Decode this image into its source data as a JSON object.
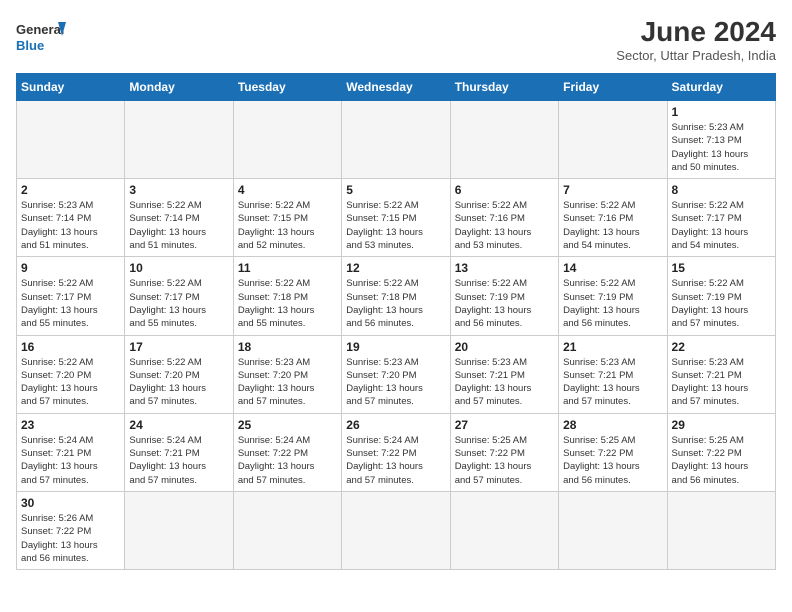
{
  "header": {
    "logo_line1": "General",
    "logo_line2": "Blue",
    "month_title": "June 2024",
    "subtitle": "Sector, Uttar Pradesh, India"
  },
  "weekdays": [
    "Sunday",
    "Monday",
    "Tuesday",
    "Wednesday",
    "Thursday",
    "Friday",
    "Saturday"
  ],
  "weeks": [
    [
      {
        "day": "",
        "info": ""
      },
      {
        "day": "",
        "info": ""
      },
      {
        "day": "",
        "info": ""
      },
      {
        "day": "",
        "info": ""
      },
      {
        "day": "",
        "info": ""
      },
      {
        "day": "",
        "info": ""
      },
      {
        "day": "1",
        "info": "Sunrise: 5:23 AM\nSunset: 7:13 PM\nDaylight: 13 hours\nand 50 minutes."
      }
    ],
    [
      {
        "day": "2",
        "info": "Sunrise: 5:23 AM\nSunset: 7:14 PM\nDaylight: 13 hours\nand 51 minutes."
      },
      {
        "day": "3",
        "info": "Sunrise: 5:22 AM\nSunset: 7:14 PM\nDaylight: 13 hours\nand 51 minutes."
      },
      {
        "day": "4",
        "info": "Sunrise: 5:22 AM\nSunset: 7:15 PM\nDaylight: 13 hours\nand 52 minutes."
      },
      {
        "day": "5",
        "info": "Sunrise: 5:22 AM\nSunset: 7:15 PM\nDaylight: 13 hours\nand 53 minutes."
      },
      {
        "day": "6",
        "info": "Sunrise: 5:22 AM\nSunset: 7:16 PM\nDaylight: 13 hours\nand 53 minutes."
      },
      {
        "day": "7",
        "info": "Sunrise: 5:22 AM\nSunset: 7:16 PM\nDaylight: 13 hours\nand 54 minutes."
      },
      {
        "day": "8",
        "info": "Sunrise: 5:22 AM\nSunset: 7:17 PM\nDaylight: 13 hours\nand 54 minutes."
      }
    ],
    [
      {
        "day": "9",
        "info": "Sunrise: 5:22 AM\nSunset: 7:17 PM\nDaylight: 13 hours\nand 55 minutes."
      },
      {
        "day": "10",
        "info": "Sunrise: 5:22 AM\nSunset: 7:17 PM\nDaylight: 13 hours\nand 55 minutes."
      },
      {
        "day": "11",
        "info": "Sunrise: 5:22 AM\nSunset: 7:18 PM\nDaylight: 13 hours\nand 55 minutes."
      },
      {
        "day": "12",
        "info": "Sunrise: 5:22 AM\nSunset: 7:18 PM\nDaylight: 13 hours\nand 56 minutes."
      },
      {
        "day": "13",
        "info": "Sunrise: 5:22 AM\nSunset: 7:19 PM\nDaylight: 13 hours\nand 56 minutes."
      },
      {
        "day": "14",
        "info": "Sunrise: 5:22 AM\nSunset: 7:19 PM\nDaylight: 13 hours\nand 56 minutes."
      },
      {
        "day": "15",
        "info": "Sunrise: 5:22 AM\nSunset: 7:19 PM\nDaylight: 13 hours\nand 57 minutes."
      }
    ],
    [
      {
        "day": "16",
        "info": "Sunrise: 5:22 AM\nSunset: 7:20 PM\nDaylight: 13 hours\nand 57 minutes."
      },
      {
        "day": "17",
        "info": "Sunrise: 5:22 AM\nSunset: 7:20 PM\nDaylight: 13 hours\nand 57 minutes."
      },
      {
        "day": "18",
        "info": "Sunrise: 5:23 AM\nSunset: 7:20 PM\nDaylight: 13 hours\nand 57 minutes."
      },
      {
        "day": "19",
        "info": "Sunrise: 5:23 AM\nSunset: 7:20 PM\nDaylight: 13 hours\nand 57 minutes."
      },
      {
        "day": "20",
        "info": "Sunrise: 5:23 AM\nSunset: 7:21 PM\nDaylight: 13 hours\nand 57 minutes."
      },
      {
        "day": "21",
        "info": "Sunrise: 5:23 AM\nSunset: 7:21 PM\nDaylight: 13 hours\nand 57 minutes."
      },
      {
        "day": "22",
        "info": "Sunrise: 5:23 AM\nSunset: 7:21 PM\nDaylight: 13 hours\nand 57 minutes."
      }
    ],
    [
      {
        "day": "23",
        "info": "Sunrise: 5:24 AM\nSunset: 7:21 PM\nDaylight: 13 hours\nand 57 minutes."
      },
      {
        "day": "24",
        "info": "Sunrise: 5:24 AM\nSunset: 7:21 PM\nDaylight: 13 hours\nand 57 minutes."
      },
      {
        "day": "25",
        "info": "Sunrise: 5:24 AM\nSunset: 7:22 PM\nDaylight: 13 hours\nand 57 minutes."
      },
      {
        "day": "26",
        "info": "Sunrise: 5:24 AM\nSunset: 7:22 PM\nDaylight: 13 hours\nand 57 minutes."
      },
      {
        "day": "27",
        "info": "Sunrise: 5:25 AM\nSunset: 7:22 PM\nDaylight: 13 hours\nand 57 minutes."
      },
      {
        "day": "28",
        "info": "Sunrise: 5:25 AM\nSunset: 7:22 PM\nDaylight: 13 hours\nand 56 minutes."
      },
      {
        "day": "29",
        "info": "Sunrise: 5:25 AM\nSunset: 7:22 PM\nDaylight: 13 hours\nand 56 minutes."
      }
    ],
    [
      {
        "day": "30",
        "info": "Sunrise: 5:26 AM\nSunset: 7:22 PM\nDaylight: 13 hours\nand 56 minutes."
      },
      {
        "day": "",
        "info": ""
      },
      {
        "day": "",
        "info": ""
      },
      {
        "day": "",
        "info": ""
      },
      {
        "day": "",
        "info": ""
      },
      {
        "day": "",
        "info": ""
      },
      {
        "day": "",
        "info": ""
      }
    ]
  ]
}
